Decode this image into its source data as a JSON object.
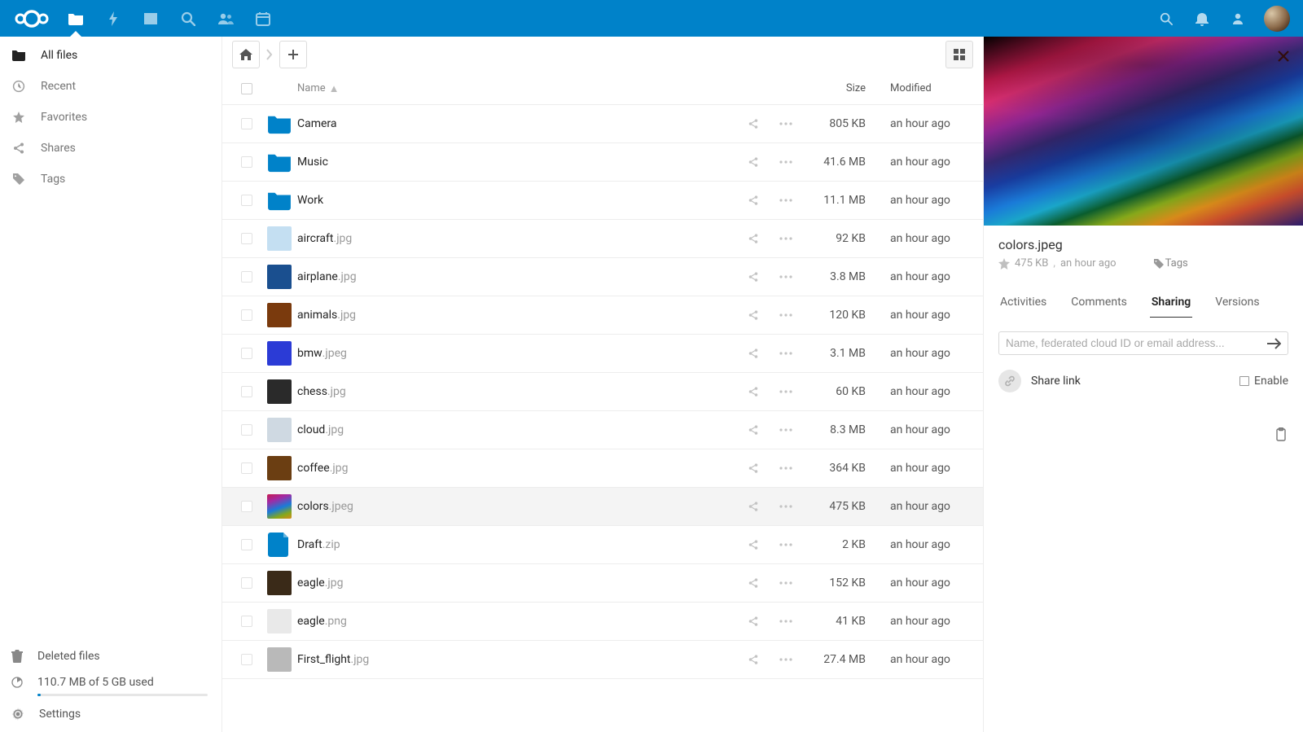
{
  "sidebar": {
    "items": [
      {
        "label": "All files",
        "icon": "folder-solid",
        "active": true
      },
      {
        "label": "Recent",
        "icon": "clock",
        "active": false
      },
      {
        "label": "Favorites",
        "icon": "star",
        "active": false
      },
      {
        "label": "Shares",
        "icon": "share",
        "active": false
      },
      {
        "label": "Tags",
        "icon": "tag",
        "active": false
      }
    ],
    "deleted_label": "Deleted files",
    "quota_label": "110.7 MB of 5 GB used",
    "settings_label": "Settings"
  },
  "table": {
    "header": {
      "name": "Name",
      "size": "Size",
      "modified": "Modified"
    }
  },
  "files": [
    {
      "kind": "folder",
      "name": "Camera",
      "ext": "",
      "size": "805 KB",
      "modified": "an hour ago",
      "thumb": "folder"
    },
    {
      "kind": "folder",
      "name": "Music",
      "ext": "",
      "size": "41.6 MB",
      "modified": "an hour ago",
      "thumb": "folder"
    },
    {
      "kind": "folder",
      "name": "Work",
      "ext": "",
      "size": "11.1 MB",
      "modified": "an hour ago",
      "thumb": "folder"
    },
    {
      "kind": "image",
      "name": "aircraft",
      "ext": ".jpg",
      "size": "92 KB",
      "modified": "an hour ago",
      "thumb": "#c4dff2"
    },
    {
      "kind": "image",
      "name": "airplane",
      "ext": ".jpg",
      "size": "3.8 MB",
      "modified": "an hour ago",
      "thumb": "#1a4f8f"
    },
    {
      "kind": "image",
      "name": "animals",
      "ext": ".jpg",
      "size": "120 KB",
      "modified": "an hour ago",
      "thumb": "#7a3a0d"
    },
    {
      "kind": "image",
      "name": "bmw",
      "ext": ".jpeg",
      "size": "3.1 MB",
      "modified": "an hour ago",
      "thumb": "#2b3bd6"
    },
    {
      "kind": "image",
      "name": "chess",
      "ext": ".jpg",
      "size": "60 KB",
      "modified": "an hour ago",
      "thumb": "#2a2a2a"
    },
    {
      "kind": "image",
      "name": "cloud",
      "ext": ".jpg",
      "size": "8.3 MB",
      "modified": "an hour ago",
      "thumb": "#cfd9e2"
    },
    {
      "kind": "image",
      "name": "coffee",
      "ext": ".jpg",
      "size": "364 KB",
      "modified": "an hour ago",
      "thumb": "#6b3e12"
    },
    {
      "kind": "image",
      "name": "colors",
      "ext": ".jpeg",
      "size": "475 KB",
      "modified": "an hour ago",
      "thumb": "colors",
      "selected": true
    },
    {
      "kind": "file",
      "name": "Draft",
      "ext": ".zip",
      "size": "2 KB",
      "modified": "an hour ago",
      "thumb": "zip"
    },
    {
      "kind": "image",
      "name": "eagle",
      "ext": ".jpg",
      "size": "152 KB",
      "modified": "an hour ago",
      "thumb": "#3a2a18"
    },
    {
      "kind": "image",
      "name": "eagle",
      "ext": ".png",
      "size": "41 KB",
      "modified": "an hour ago",
      "thumb": "#e9e9e9"
    },
    {
      "kind": "image",
      "name": "First_flight",
      "ext": ".jpg",
      "size": "27.4 MB",
      "modified": "an hour ago",
      "thumb": "#b9b9b9"
    }
  ],
  "details": {
    "file_name": "colors.jpeg",
    "file_size": "475 KB",
    "file_modified": "an hour ago",
    "tags_label": "Tags",
    "tabs": [
      {
        "label": "Activities",
        "active": false
      },
      {
        "label": "Comments",
        "active": false
      },
      {
        "label": "Sharing",
        "active": true
      },
      {
        "label": "Versions",
        "active": false
      }
    ],
    "share_placeholder": "Name, federated cloud ID or email address...",
    "share_link_label": "Share link",
    "enable_label": "Enable"
  }
}
